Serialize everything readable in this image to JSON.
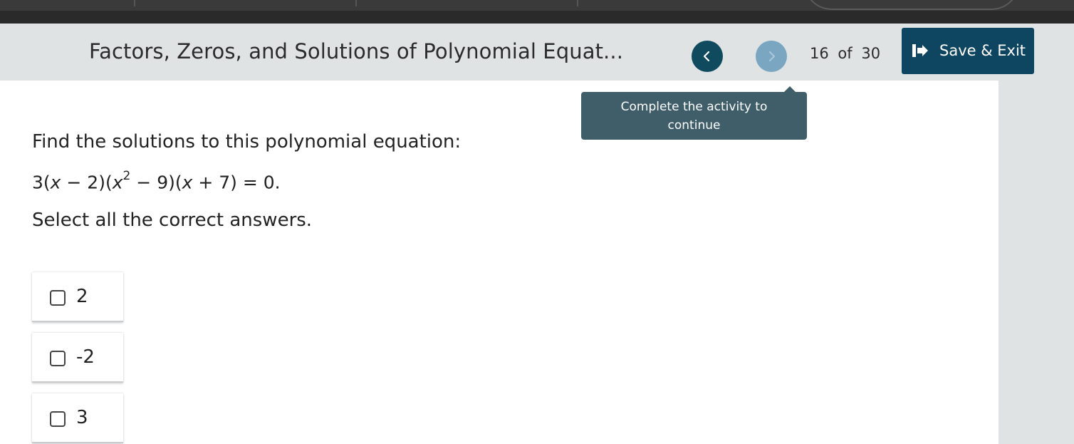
{
  "header": {
    "title": "Factors, Zeros, and Solutions of Polynomial Equat...",
    "page_current": "16",
    "page_of": "of",
    "page_total": "30",
    "save_exit_label": "Save & Exit",
    "colors": {
      "header_bg": "#dfe3e4",
      "primary": "#0e4560",
      "next_disabled": "#7aa6c2"
    }
  },
  "tooltip": {
    "line1": "Complete the activity to",
    "line2": "continue"
  },
  "question": {
    "prompt": "Find the solutions to this polynomial equation:",
    "eq_part1": "3(",
    "eq_x1": "x",
    "eq_part2": " − 2)(",
    "eq_x2": "x",
    "eq_exp": "2",
    "eq_part3": " − 9)(",
    "eq_x3": "x",
    "eq_part4": " + 7) = 0.",
    "instruction": "Select all the correct answers."
  },
  "options": [
    {
      "value": "2",
      "checked": false
    },
    {
      "value": "-2",
      "checked": false
    },
    {
      "value": "3",
      "checked": false
    }
  ],
  "icons": {
    "prev": "chevron-left-icon",
    "next": "chevron-right-icon",
    "exit": "exit-arrow-icon"
  }
}
